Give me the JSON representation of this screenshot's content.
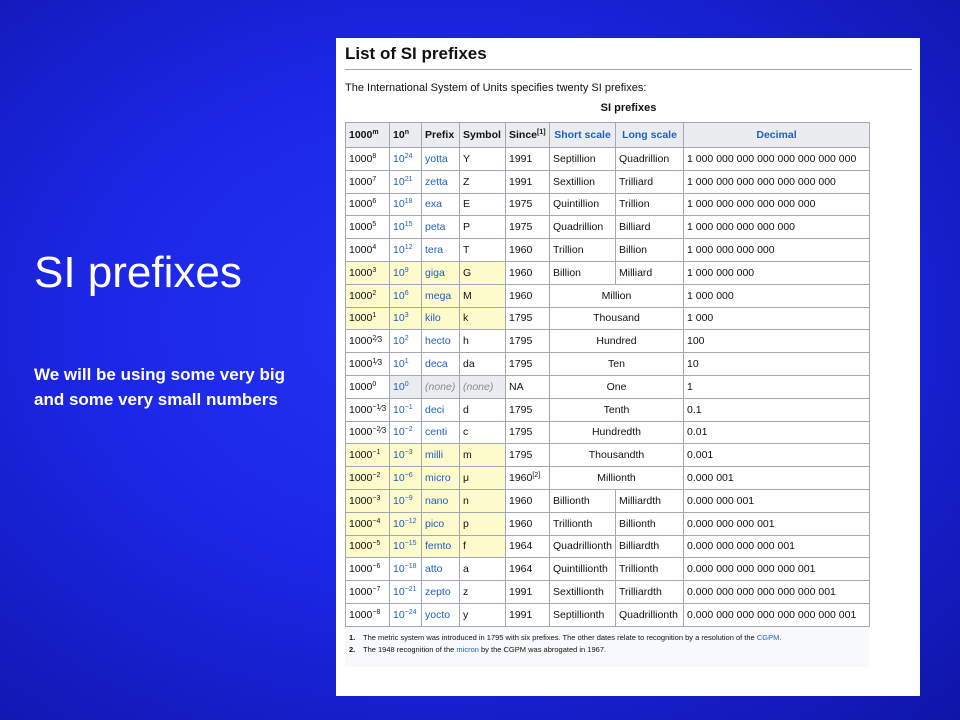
{
  "slide": {
    "title": "SI prefixes",
    "body": "We will be using some very big and some very small numbers"
  },
  "panel": {
    "heading": "List of SI prefixes",
    "intro": "The International System of Units specifies twenty SI prefixes:",
    "caption": "SI prefixes",
    "headers": {
      "h1000": "1000",
      "h1000_sup": "m",
      "h10": "10",
      "h10_sup": "n",
      "prefix": "Prefix",
      "symbol": "Symbol",
      "since": "Since",
      "since_sup": "[1]",
      "short": "Short scale",
      "long": "Long scale",
      "decimal": "Decimal"
    },
    "rows": [
      {
        "b": "1000",
        "be": "8",
        "t": "10",
        "te": "24",
        "prefix": "yotta",
        "symbol": "Y",
        "since": "1991",
        "short": "Septillion",
        "long": "Quadrillion",
        "decimal": "1 000 000 000 000 000 000 000 000"
      },
      {
        "b": "1000",
        "be": "7",
        "t": "10",
        "te": "21",
        "prefix": "zetta",
        "symbol": "Z",
        "since": "1991",
        "short": "Sextillion",
        "long": "Trilliard",
        "decimal": "1 000 000 000 000 000 000 000"
      },
      {
        "b": "1000",
        "be": "6",
        "t": "10",
        "te": "18",
        "prefix": "exa",
        "symbol": "E",
        "since": "1975",
        "short": "Quintillion",
        "long": "Trillion",
        "decimal": "1 000 000 000 000 000 000"
      },
      {
        "b": "1000",
        "be": "5",
        "t": "10",
        "te": "15",
        "prefix": "peta",
        "symbol": "P",
        "since": "1975",
        "short": "Quadrillion",
        "long": "Billiard",
        "decimal": "1 000 000 000 000 000"
      },
      {
        "b": "1000",
        "be": "4",
        "t": "10",
        "te": "12",
        "prefix": "tera",
        "symbol": "T",
        "since": "1960",
        "short": "Trillion",
        "long": "Billion",
        "decimal": "1 000 000 000 000"
      },
      {
        "b": "1000",
        "be": "3",
        "t": "10",
        "te": "9",
        "prefix": "giga",
        "symbol": "G",
        "since": "1960",
        "short": "Billion",
        "long": "Milliard",
        "decimal": "1 000 000 000",
        "hl": true
      },
      {
        "b": "1000",
        "be": "2",
        "t": "10",
        "te": "6",
        "prefix": "mega",
        "symbol": "M",
        "since": "1960",
        "merged": "Million",
        "decimal": "1 000 000",
        "hl": true
      },
      {
        "b": "1000",
        "be": "1",
        "t": "10",
        "te": "3",
        "prefix": "kilo",
        "symbol": "k",
        "since": "1795",
        "merged": "Thousand",
        "decimal": "1 000",
        "hl": true
      },
      {
        "b": "1000",
        "be": "",
        "frac_n": "2",
        "frac_d": "3",
        "t": "10",
        "te": "2",
        "prefix": "hecto",
        "symbol": "h",
        "since": "1795",
        "merged": "Hundred",
        "decimal": "100"
      },
      {
        "b": "1000",
        "be": "",
        "frac_n": "1",
        "frac_d": "3",
        "t": "10",
        "te": "1",
        "prefix": "deca",
        "symbol": "da",
        "since": "1795",
        "merged": "Ten",
        "decimal": "10"
      },
      {
        "b": "1000",
        "be": "0",
        "t": "10",
        "te": "0",
        "prefix": "(none)",
        "symbol": "(none)",
        "since": "NA",
        "merged": "One",
        "decimal": "1",
        "gray": true
      },
      {
        "b": "1000",
        "be": "−",
        "frac_n": "1",
        "frac_d": "3",
        "t": "10",
        "te": "−1",
        "prefix": "deci",
        "symbol": "d",
        "since": "1795",
        "merged": "Tenth",
        "decimal": "0.1"
      },
      {
        "b": "1000",
        "be": "−",
        "frac_n": "2",
        "frac_d": "3",
        "t": "10",
        "te": "−2",
        "prefix": "centi",
        "symbol": "c",
        "since": "1795",
        "merged": "Hundredth",
        "decimal": "0.01"
      },
      {
        "b": "1000",
        "be": "−1",
        "t": "10",
        "te": "−3",
        "prefix": "milli",
        "symbol": "m",
        "since": "1795",
        "merged": "Thousandth",
        "decimal": "0.001",
        "hl": true
      },
      {
        "b": "1000",
        "be": "−2",
        "t": "10",
        "te": "−6",
        "prefix": "micro",
        "symbol": "μ",
        "since": "1960",
        "since_sup": "[2]",
        "merged": "Millionth",
        "decimal": "0.000 001",
        "hl": true
      },
      {
        "b": "1000",
        "be": "−3",
        "t": "10",
        "te": "−9",
        "prefix": "nano",
        "symbol": "n",
        "since": "1960",
        "short": "Billionth",
        "long": "Milliardth",
        "decimal": "0.000 000 001",
        "hl": true
      },
      {
        "b": "1000",
        "be": "−4",
        "t": "10",
        "te": "−12",
        "prefix": "pico",
        "symbol": "p",
        "since": "1960",
        "short": "Trillionth",
        "long": "Billionth",
        "decimal": "0.000 000 000 001",
        "hl": true
      },
      {
        "b": "1000",
        "be": "−5",
        "t": "10",
        "te": "−15",
        "prefix": "femto",
        "symbol": "f",
        "since": "1964",
        "short": "Quadrillionth",
        "long": "Billiardth",
        "decimal": "0.000 000 000 000 001",
        "hl": true
      },
      {
        "b": "1000",
        "be": "−6",
        "t": "10",
        "te": "−18",
        "prefix": "atto",
        "symbol": "a",
        "since": "1964",
        "short": "Quintillionth",
        "long": "Trillionth",
        "decimal": "0.000 000 000 000 000 001"
      },
      {
        "b": "1000",
        "be": "−7",
        "t": "10",
        "te": "−21",
        "prefix": "zepto",
        "symbol": "z",
        "since": "1991",
        "short": "Sextillionth",
        "long": "Trilliardth",
        "decimal": "0.000 000 000 000 000 000 001"
      },
      {
        "b": "1000",
        "be": "−8",
        "t": "10",
        "te": "−24",
        "prefix": "yocto",
        "symbol": "y",
        "since": "1991",
        "short": "Septillionth",
        "long": "Quadrillionth",
        "decimal": "0.000 000 000 000 000 000 000 001"
      }
    ],
    "notes": [
      {
        "num": "1.",
        "before": "The metric system was introduced in 1795 with six prefixes. The other dates relate to recognition by a resolution of the ",
        "link": "CGPM",
        "after": "."
      },
      {
        "num": "2.",
        "before": "The 1948 recognition of the ",
        "link": "micron",
        "after": " by the CGPM was abrogated in 1967."
      }
    ]
  }
}
